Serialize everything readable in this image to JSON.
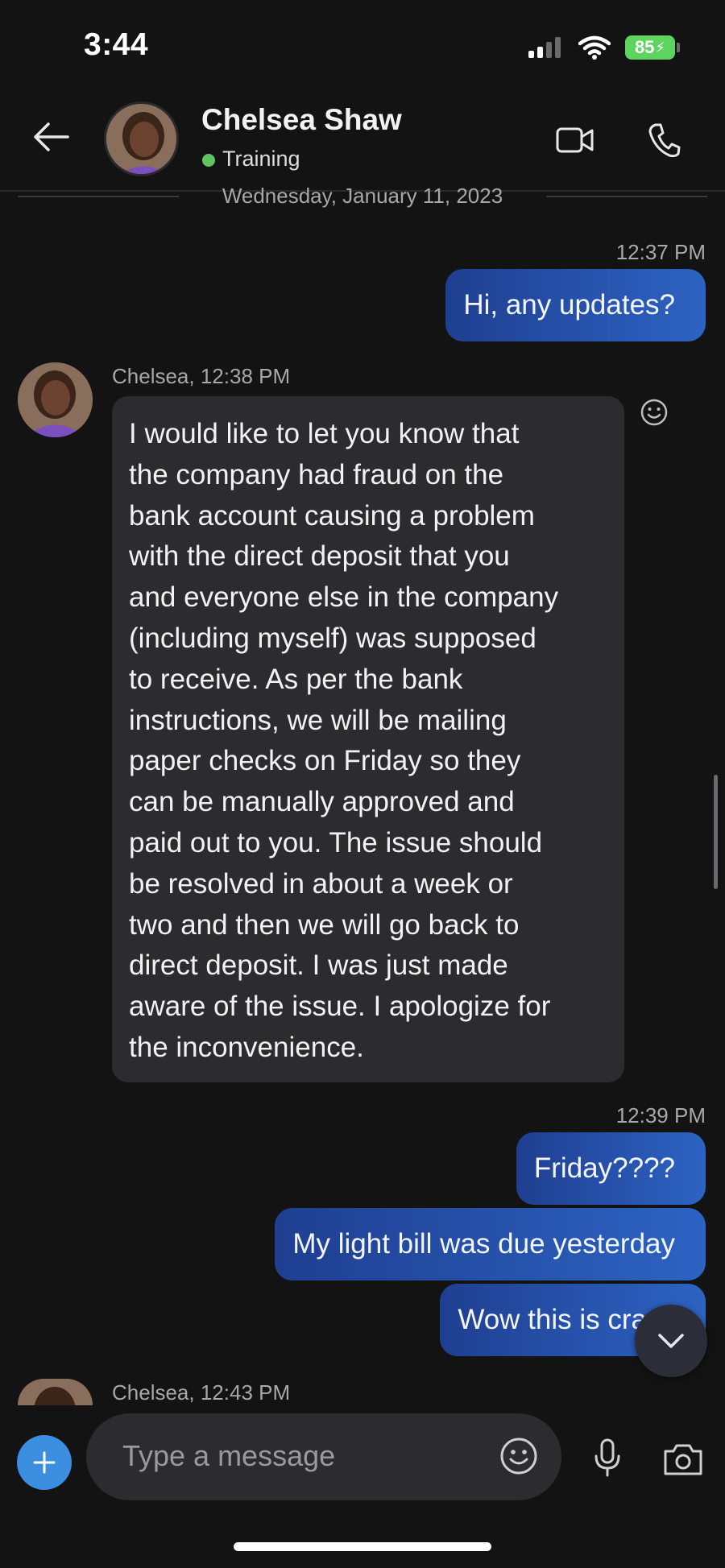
{
  "status_bar": {
    "time": "3:44",
    "battery": "85"
  },
  "header": {
    "contact_name": "Chelsea Shaw",
    "presence": "Training",
    "presence_color": "#5fc45f",
    "icons": [
      "back-arrow-icon",
      "video-call-icon",
      "phone-icon"
    ]
  },
  "conversation": {
    "date_separator": "Wednesday, January 11, 2023",
    "messages": [
      {
        "direction": "outgoing",
        "time": "12:37 PM",
        "text": "Hi, any updates?"
      },
      {
        "direction": "incoming",
        "meta": "Chelsea, 12:38 PM",
        "lines": [
          "I would like to let you know that",
          "the company had fraud on the",
          "bank account causing a problem",
          "with the direct deposit that you",
          "and everyone else in the company",
          "(including myself) was supposed",
          "to receive. As per the bank",
          "instructions, we will be mailing",
          "paper checks on Friday so they",
          "can be manually approved and",
          "paid out to you. The issue should",
          "be resolved in about a week or",
          "two and then we will go back to",
          "direct deposit. I was just made",
          "aware of the issue. I apologize for",
          "the inconvenience."
        ]
      },
      {
        "direction": "outgoing",
        "time": "12:39 PM",
        "texts": [
          "Friday????",
          "My light bill was due yesterday",
          "Wow this is crazy"
        ]
      },
      {
        "direction": "incoming",
        "meta": "Chelsea, 12:43 PM"
      }
    ]
  },
  "composer": {
    "placeholder": "Type a message"
  },
  "colors": {
    "background": "#131314",
    "incoming_bubble": "#2c2c2e",
    "outgoing_bubble_start": "#1f3f91",
    "outgoing_bubble_end": "#2d63c3",
    "accent": "#3b8ee0"
  }
}
